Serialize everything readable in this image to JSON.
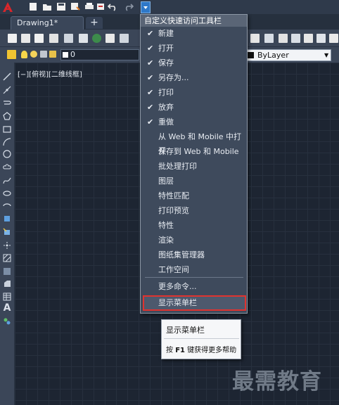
{
  "quick_access": {
    "icons": [
      "new-icon",
      "open-icon",
      "save-icon",
      "save-as-icon",
      "print-icon",
      "plot-icon",
      "undo-icon",
      "redo-icon"
    ],
    "dropdown_icon": "chevron-down-icon"
  },
  "tabs": {
    "document": "Drawing1*",
    "new_tab": "+"
  },
  "layer_bar": {
    "current_layer": "0",
    "color_value": "ByLayer"
  },
  "viewport": {
    "label": "[−][俯视][二维线框]"
  },
  "palette": {
    "text_tool": "A"
  },
  "menu": {
    "header": "自定义快速访问工具栏",
    "items": [
      {
        "label": "新建",
        "checked": true
      },
      {
        "label": "打开",
        "checked": true
      },
      {
        "label": "保存",
        "checked": true
      },
      {
        "label": "另存为...",
        "checked": true
      },
      {
        "label": "打印",
        "checked": true
      },
      {
        "label": "放弃",
        "checked": true
      },
      {
        "label": "重做",
        "checked": true
      },
      {
        "label": "从 Web 和 Mobile 中打开",
        "checked": false
      },
      {
        "label": "保存到 Web 和 Mobile",
        "checked": false
      },
      {
        "label": "批处理打印",
        "checked": false
      },
      {
        "label": "图层",
        "checked": false
      },
      {
        "label": "特性匹配",
        "checked": false
      },
      {
        "label": "打印预览",
        "checked": false
      },
      {
        "label": "特性",
        "checked": false
      },
      {
        "label": "渲染",
        "checked": false
      },
      {
        "label": "图纸集管理器",
        "checked": false
      },
      {
        "label": "工作空间",
        "checked": false
      }
    ],
    "more_commands": "更多命令...",
    "show_menu_bar": "显示菜单栏",
    "check_mark": "✔"
  },
  "tooltip": {
    "title": "显示菜单栏",
    "help_prefix": "按",
    "help_key": "F1",
    "help_suffix": "键获得更多帮助"
  },
  "watermark": "最需教育",
  "colors": {
    "highlight": "#e0332f",
    "canvas": "#1d2532",
    "menu_bg": "#3e4a5c"
  }
}
